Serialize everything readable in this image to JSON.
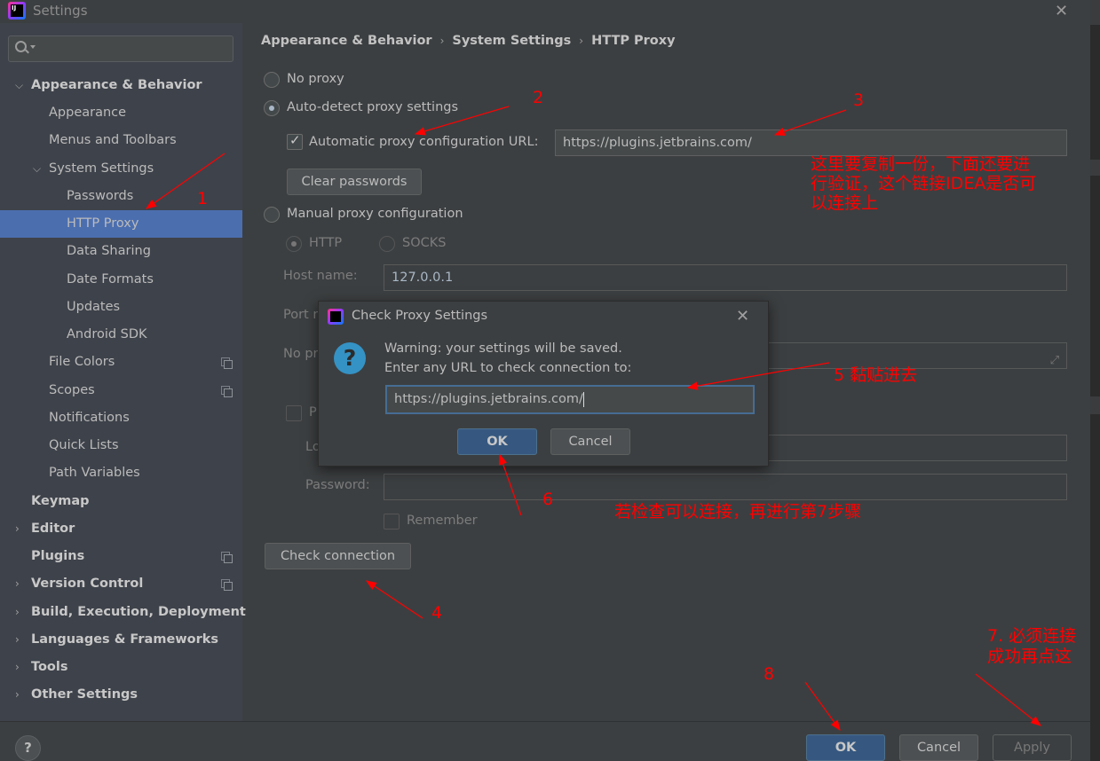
{
  "window": {
    "title": "Settings",
    "logo_text": "IJ"
  },
  "search": {
    "placeholder": ""
  },
  "sidebar": {
    "items": [
      {
        "label": "Appearance & Behavior",
        "expanded": true,
        "bold": true
      },
      {
        "label": "Appearance"
      },
      {
        "label": "Menus and Toolbars"
      },
      {
        "label": "System Settings",
        "expanded": true
      },
      {
        "label": "Passwords"
      },
      {
        "label": "HTTP Proxy",
        "selected": true
      },
      {
        "label": "Data Sharing"
      },
      {
        "label": "Date Formats"
      },
      {
        "label": "Updates"
      },
      {
        "label": "Android SDK"
      },
      {
        "label": "File Colors",
        "project_icon": true
      },
      {
        "label": "Scopes",
        "project_icon": true
      },
      {
        "label": "Notifications"
      },
      {
        "label": "Quick Lists"
      },
      {
        "label": "Path Variables"
      },
      {
        "label": "Keymap",
        "bold": true
      },
      {
        "label": "Editor",
        "bold": true,
        "collapsed": true
      },
      {
        "label": "Plugins",
        "bold": true,
        "project_icon": true
      },
      {
        "label": "Version Control",
        "bold": true,
        "collapsed": true,
        "project_icon": true
      },
      {
        "label": "Build, Execution, Deployment",
        "bold": true,
        "collapsed": true
      },
      {
        "label": "Languages & Frameworks",
        "bold": true,
        "collapsed": true
      },
      {
        "label": "Tools",
        "bold": true,
        "collapsed": true
      },
      {
        "label": "Other Settings",
        "bold": true,
        "collapsed": true
      }
    ]
  },
  "breadcrumb": [
    "Appearance & Behavior",
    "System Settings",
    "HTTP Proxy"
  ],
  "proxy": {
    "no_proxy": "No proxy",
    "auto_detect": "Auto-detect proxy settings",
    "auto_config_label": "Automatic proxy configuration URL:",
    "auto_config_checked": true,
    "auto_config_url": "https://plugins.jetbrains.com/",
    "clear_passwords": "Clear passwords",
    "manual": "Manual proxy configuration",
    "http": "HTTP",
    "socks": "SOCKS",
    "host_label": "Host name:",
    "host_value": "127.0.0.1",
    "port_label": "Port n",
    "no_proxy_for_label": "No pr",
    "auth_label": "P",
    "login_label": "Lo",
    "password_label": "Password:",
    "remember": "Remember",
    "check_connection": "Check connection"
  },
  "dialog": {
    "title": "Check Proxy Settings",
    "line1": "Warning: your settings will be saved.",
    "line2": "Enter any URL to check connection to:",
    "url_value": "https://plugins.jetbrains.com/",
    "ok": "OK",
    "cancel": "Cancel"
  },
  "footer": {
    "help": "?",
    "ok": "OK",
    "cancel": "Cancel",
    "apply": "Apply"
  },
  "annotations": {
    "n1": "1",
    "n2": "2",
    "n3": "3",
    "n4": "4",
    "n6": "6",
    "n8": "8",
    "note3_line1": "这里要复制一份，下面还要进",
    "note3_line2": "行验证，这个链接IDEA是否可",
    "note3_line3": "以连接上",
    "note5": "5 黏贴进去",
    "note6": "若检查可以连接，再进行第7步骤",
    "note7_line1": "7. 必须连接",
    "note7_line2": "成功再点这",
    "color": "#ff0000"
  },
  "colors": {
    "selection": "#4b6eaf",
    "primary_button": "#365880",
    "background": "#3c3f41",
    "sidebar": "#3e424a"
  }
}
